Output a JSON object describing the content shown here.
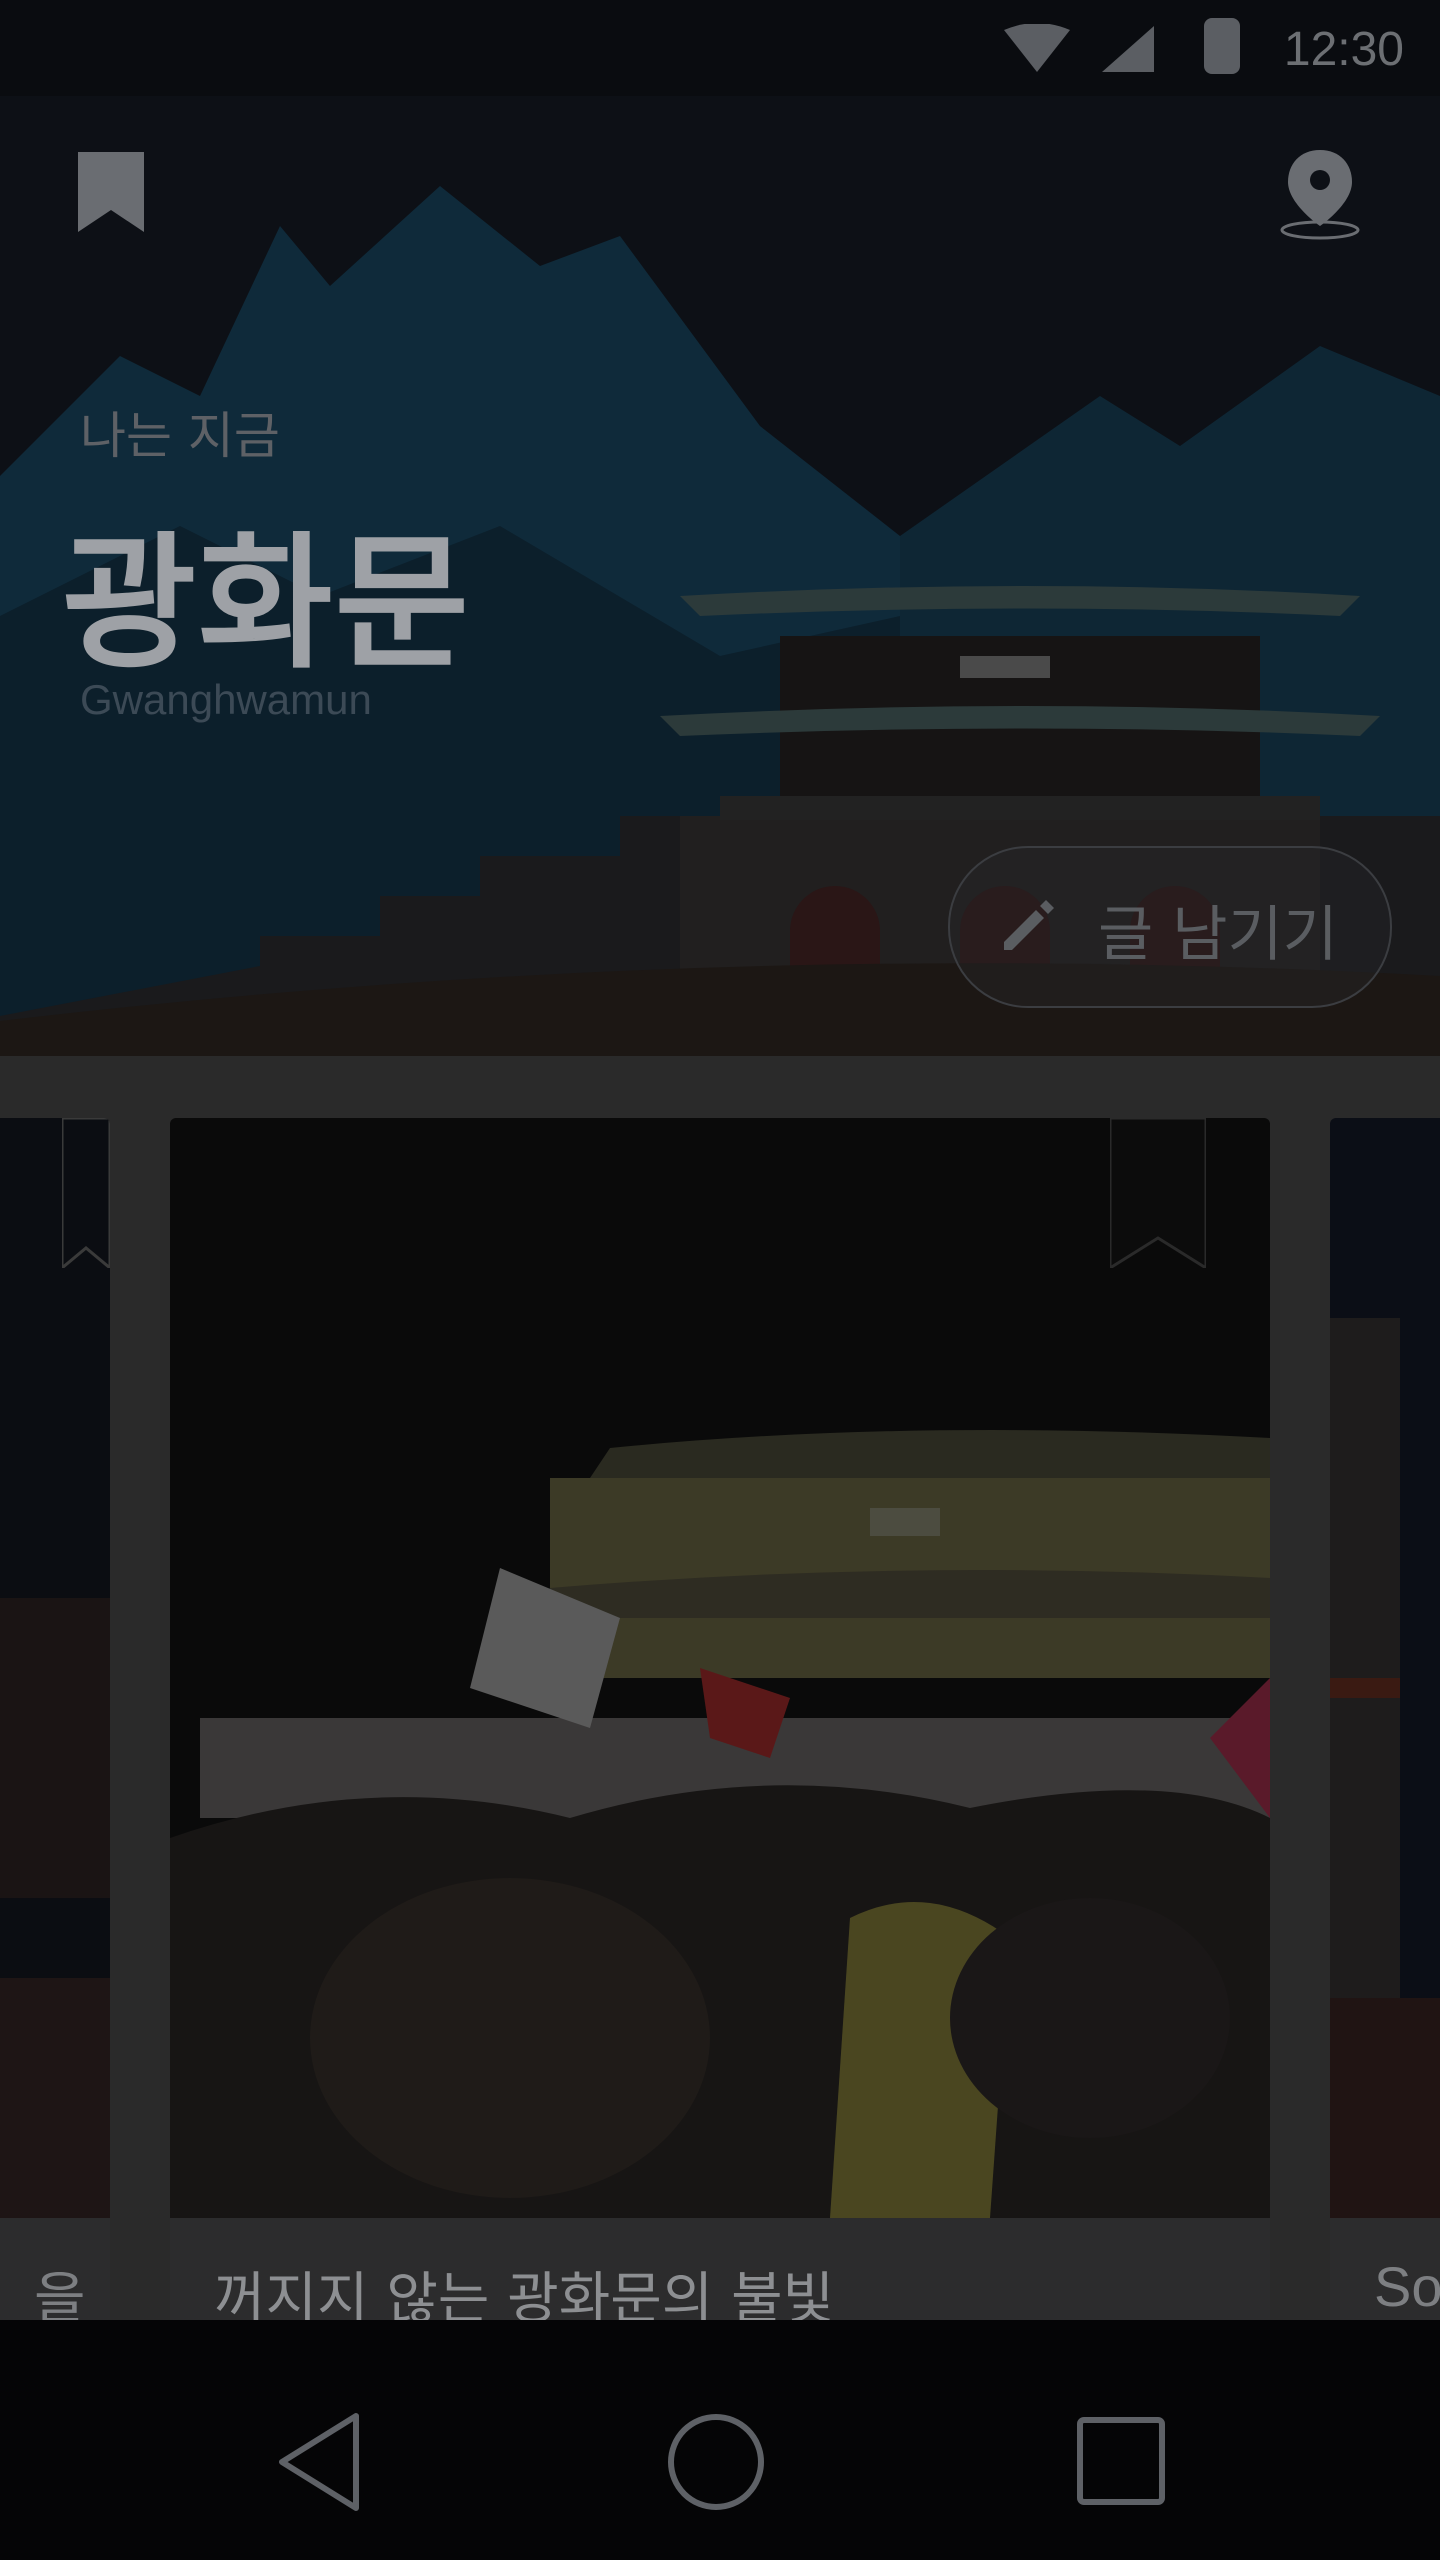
{
  "status_bar": {
    "time": "12:30"
  },
  "hero": {
    "subtitle": "나는 지금",
    "title": "광화문",
    "romanized": "Gwanghwamun",
    "write_button_label": "글 남기기"
  },
  "cards": {
    "left_partial_text": "을",
    "main_title": "꺼지지 않는 광화문의 불빛",
    "right_partial_text": "So"
  },
  "colors": {
    "background_overlay": "#2a2a2a",
    "hero_sky": "#0d1016",
    "mountain": "#0f2a3a",
    "navbar": "#050506"
  },
  "icons": {
    "top_left": "bookmark-icon",
    "top_right": "location-pin-icon",
    "write": "pencil-icon",
    "nav": [
      "back-icon",
      "home-icon",
      "recents-icon"
    ]
  }
}
